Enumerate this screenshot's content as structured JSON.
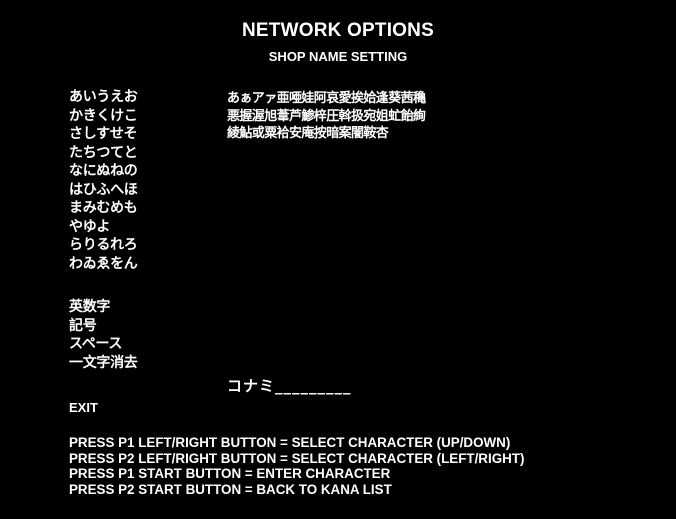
{
  "header": {
    "title": "NETWORK OPTIONS",
    "subtitle": "SHOP NAME SETTING"
  },
  "kana_rows": [
    "あいうえお",
    "かきくけこ",
    "さしすせそ",
    "たちつてと",
    "なにぬねの",
    "はひふへほ",
    "まみむめも",
    "やゆよ",
    "らりるれろ",
    "わゐゑをん"
  ],
  "menu_items": [
    "英数字",
    "記号",
    "スペース",
    "一文字消去"
  ],
  "exit_label": "EXIT",
  "character_grid": [
    "あぁアァ亜唖娃阿哀愛挨姶逢葵茜穐",
    "悪握渥旭葦芦鯵梓圧斡扱宛姐虻飴絢",
    "綾鮎或粟袷安庵按暗案闇鞍杏"
  ],
  "name_entry": {
    "value": "コナミ_________"
  },
  "instructions": [
    "PRESS P1 LEFT/RIGHT BUTTON = SELECT CHARACTER (UP/DOWN)",
    "PRESS P2 LEFT/RIGHT BUTTON = SELECT CHARACTER (LEFT/RIGHT)",
    "PRESS P1 START BUTTON = ENTER CHARACTER",
    "PRESS P2 START BUTTON = BACK TO KANA LIST"
  ],
  "colors": {
    "background": "#000000",
    "text": "#ffffff"
  }
}
